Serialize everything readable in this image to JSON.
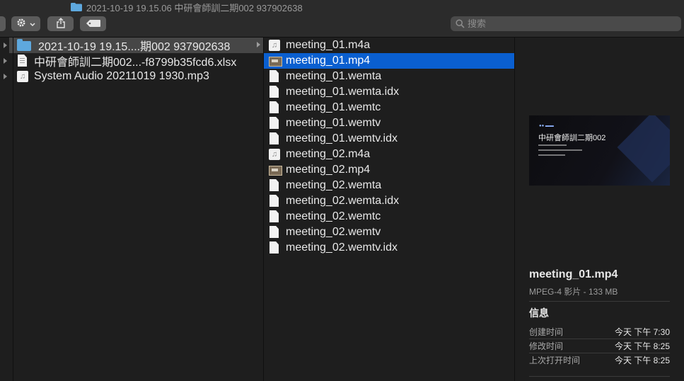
{
  "window": {
    "title": "2021-10-19 19.15.06 中研會師訓二期002 937902638"
  },
  "toolbar": {
    "action_icon": "gear-icon",
    "share_icon": "share-icon",
    "tag_icon": "tag-icon"
  },
  "search": {
    "placeholder": "搜索"
  },
  "column1": {
    "items": [
      {
        "name": "2021-10-19 19.15....期002 937902638",
        "icon": "folder-icon",
        "selected": true
      },
      {
        "name": "中研會師訓二期002...-f8799b35fcd6.xlsx",
        "icon": "spreadsheet-icon"
      },
      {
        "name": "System Audio 20211019 1930.mp3",
        "icon": "audio-icon"
      }
    ]
  },
  "column2": {
    "items": [
      {
        "name": "meeting_01.m4a",
        "icon": "audio-icon"
      },
      {
        "name": "meeting_01.mp4",
        "icon": "video-icon",
        "selected": true
      },
      {
        "name": "meeting_01.wemta",
        "icon": "document-icon"
      },
      {
        "name": "meeting_01.wemta.idx",
        "icon": "document-icon"
      },
      {
        "name": "meeting_01.wemtc",
        "icon": "document-icon"
      },
      {
        "name": "meeting_01.wemtv",
        "icon": "document-icon"
      },
      {
        "name": "meeting_01.wemtv.idx",
        "icon": "document-icon"
      },
      {
        "name": "meeting_02.m4a",
        "icon": "audio-icon"
      },
      {
        "name": "meeting_02.mp4",
        "icon": "video-icon"
      },
      {
        "name": "meeting_02.wemta",
        "icon": "document-icon"
      },
      {
        "name": "meeting_02.wemta.idx",
        "icon": "document-icon"
      },
      {
        "name": "meeting_02.wemtc",
        "icon": "document-icon"
      },
      {
        "name": "meeting_02.wemtv",
        "icon": "document-icon"
      },
      {
        "name": "meeting_02.wemtv.idx",
        "icon": "document-icon"
      }
    ]
  },
  "preview": {
    "thumbnail_title": "中研會師訓二期002",
    "file_name": "meeting_01.mp4",
    "kind_size": "MPEG-4 影片 - 133 MB",
    "info_heading": "信息",
    "info": [
      {
        "label": "创建时间",
        "value": "今天 下午 7:30"
      },
      {
        "label": "修改时间",
        "value": "今天 下午 8:25"
      },
      {
        "label": "上次打开时间",
        "value": "今天 下午 8:25"
      }
    ]
  },
  "colors": {
    "selection_blue": "#0a5fd0",
    "selection_gray": "#464646",
    "background": "#1e1e1e"
  }
}
